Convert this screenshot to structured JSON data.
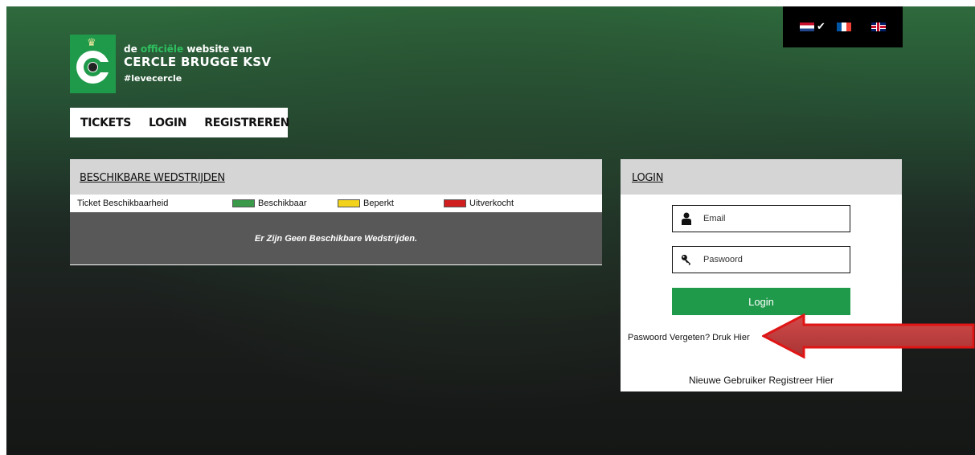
{
  "brand": {
    "line1_pre": "de",
    "line1_accent": "officiële",
    "line1_post": "website van",
    "club": "CERCLE BRUGGE KSV",
    "hashtag": "#levecercle"
  },
  "topnav": {
    "tickets": "TICKETS",
    "login": "LOGIN",
    "register": "REGISTREREN"
  },
  "languages": {
    "items": [
      "flag-nl-icon",
      "flag-fr-icon",
      "flag-uk-icon"
    ],
    "selected_mark": "✔"
  },
  "matches": {
    "title": "BESCHIKBARE WEDSTRIJDEN",
    "legend_label": "Ticket Beschikbaarheid",
    "legend": [
      {
        "label": "Beschikbaar",
        "color": "#3a9a4a"
      },
      {
        "label": "Beperkt",
        "color": "#f2d21b"
      },
      {
        "label": "Uitverkocht",
        "color": "#d11f1f"
      }
    ],
    "empty_message": "Er Zijn Geen Beschikbare Wedstrijden."
  },
  "login": {
    "title": "LOGIN",
    "email_placeholder": "Email",
    "password_placeholder": "Paswoord",
    "submit_label": "Login",
    "forgot_text": "Paswoord Vergeten? Druk Hier",
    "register_text": "Nieuwe Gebruiker Registreer Hier"
  },
  "colors": {
    "brand_green": "#1f9a4a",
    "annotation_red": "#e01515"
  }
}
